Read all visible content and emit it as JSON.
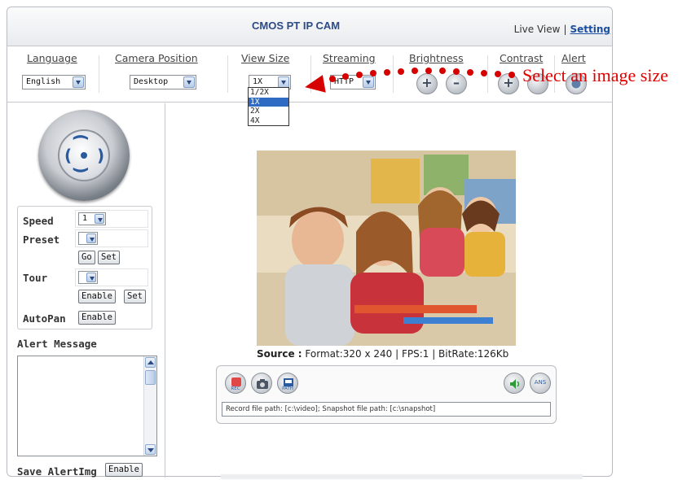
{
  "header": {
    "title": "CMOS PT IP CAM",
    "live_view": "Live View",
    "separator": "|",
    "setting": "Setting"
  },
  "toolbar": {
    "language": {
      "label": "Language",
      "value": "English"
    },
    "camera_position": {
      "label": "Camera Position",
      "value": "Desktop"
    },
    "view_size": {
      "label": "View Size",
      "value": "1X",
      "options": [
        "1/2X",
        "1X",
        "2X",
        "4X"
      ]
    },
    "streaming": {
      "label": "Streaming",
      "value": "HTTP"
    },
    "brightness": {
      "label": "Brightness",
      "plus": "+",
      "minus": "–"
    },
    "contrast": {
      "label": "Contrast",
      "plus": "+"
    },
    "alert": {
      "label": "Alert"
    }
  },
  "annotation": {
    "text": "Select an image size",
    "color": "#e00000"
  },
  "ptz_panel": {
    "speed": {
      "label": "Speed",
      "value": "1"
    },
    "preset": {
      "label": "Preset",
      "value": "",
      "go": "Go",
      "set": "Set"
    },
    "tour": {
      "label": "Tour",
      "value": "",
      "enable": "Enable",
      "set": "Set"
    },
    "autopan": {
      "label": "AutoPan",
      "enable": "Enable"
    }
  },
  "alert_panel": {
    "title": "Alert Message",
    "message": "",
    "save_label": "Save AlertImg",
    "save_enable": "Enable"
  },
  "video": {
    "source_label": "Source :",
    "source_info": "Format:320 x 240 | FPS:1 | BitRate:126Kb"
  },
  "recording": {
    "rec": "REC",
    "path": "PATH",
    "ans": "ANS",
    "path_text": "Record file path: [c:\\video]; Snapshot file path: [c:\\snapshot]"
  },
  "icons": {
    "ptz": "ptz-joystick-icon",
    "rec": "record-icon",
    "snapshot": "camera-icon",
    "path": "folder-path-icon",
    "speaker": "speaker-icon",
    "ans": "ans-icon"
  },
  "colors": {
    "title": "#2b4a86",
    "link": "#1d4fa0",
    "selection": "#2f6ac3",
    "annotation": "#e00000"
  }
}
